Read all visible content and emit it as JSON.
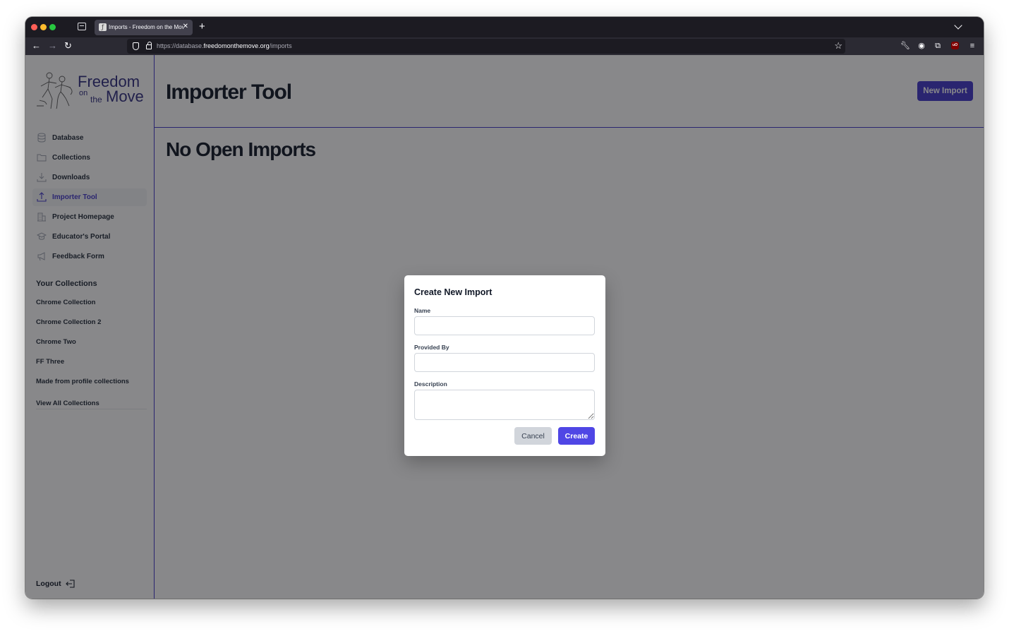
{
  "browser": {
    "tab_title": "Imports - Freedom on the Move",
    "tab_favicon": "fotm-favicon",
    "url_prefix": "https://database.",
    "url_domain": "freedomonthemove.org",
    "url_path": "/imports"
  },
  "logo": {
    "line1": "Freedom",
    "on": "on",
    "the": "the",
    "line2": "Move"
  },
  "sidebar": {
    "items": [
      {
        "label": "Database",
        "icon": "database-icon"
      },
      {
        "label": "Collections",
        "icon": "folder-icon"
      },
      {
        "label": "Downloads",
        "icon": "download-icon"
      },
      {
        "label": "Importer Tool",
        "icon": "upload-icon",
        "active": true
      },
      {
        "label": "Project Homepage",
        "icon": "building-icon"
      },
      {
        "label": "Educator's Portal",
        "icon": "graduation-cap-icon"
      },
      {
        "label": "Feedback Form",
        "icon": "megaphone-icon"
      }
    ],
    "collections_title": "Your Collections",
    "collections": [
      "Chrome Collection",
      "Chrome Collection 2",
      "Chrome Two",
      "FF Three",
      "Made from profile collections"
    ],
    "view_all": "View All Collections",
    "logout": "Logout"
  },
  "main": {
    "title": "Importer Tool",
    "new_import_button": "New Import",
    "subheading": "No Open Imports"
  },
  "modal": {
    "title": "Create New Import",
    "name_label": "Name",
    "name_value": "",
    "provided_by_label": "Provided By",
    "provided_by_value": "",
    "description_label": "Description",
    "description_value": "",
    "cancel_label": "Cancel",
    "create_label": "Create"
  },
  "colors": {
    "accent": "#4338ca",
    "create_button": "#4f46e5",
    "brand_text": "#312e81"
  }
}
